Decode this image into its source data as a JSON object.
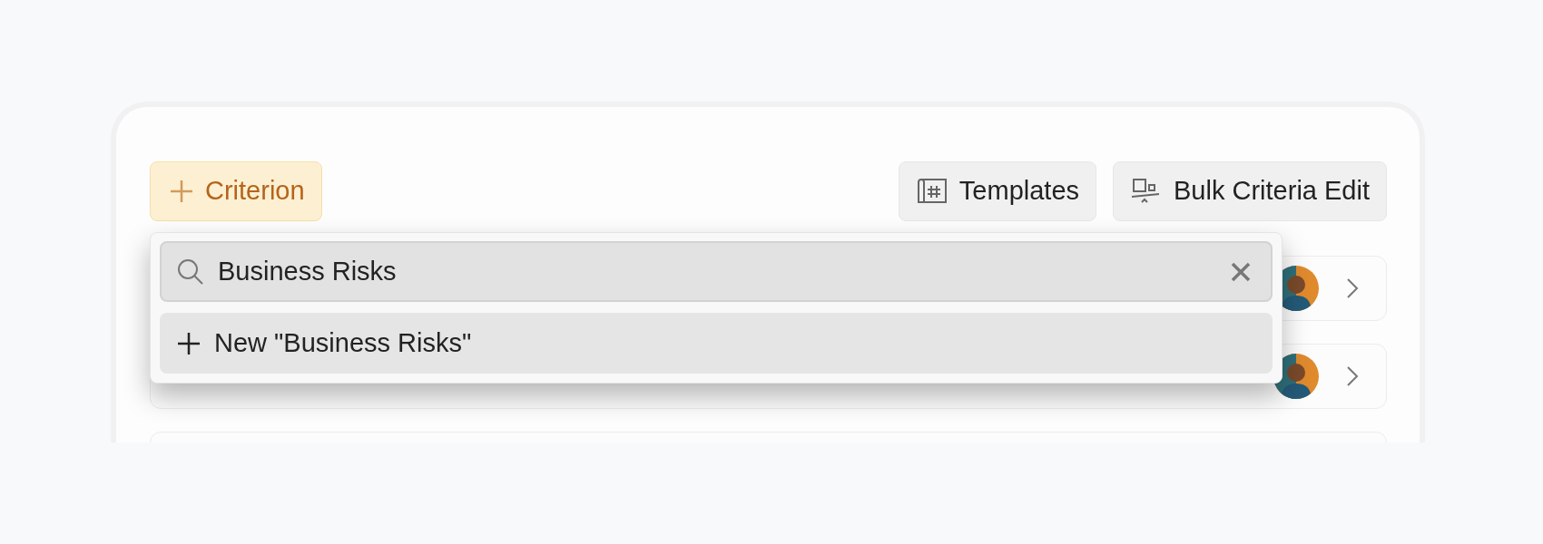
{
  "toolbar": {
    "add_button": {
      "label": "Criterion"
    },
    "buttons": [
      {
        "label": "Templates",
        "kind": "templates"
      },
      {
        "label": "Bulk Criteria Edit",
        "kind": "bulk"
      }
    ]
  },
  "rows": [
    {
      "kind": "picture"
    },
    {
      "kind": "picture"
    },
    {
      "kind": "empty"
    }
  ],
  "dropdown": {
    "search": {
      "value": "Business Risks"
    },
    "options": [
      {
        "label": "New \"Business Risks\"",
        "kind": "create"
      }
    ]
  }
}
